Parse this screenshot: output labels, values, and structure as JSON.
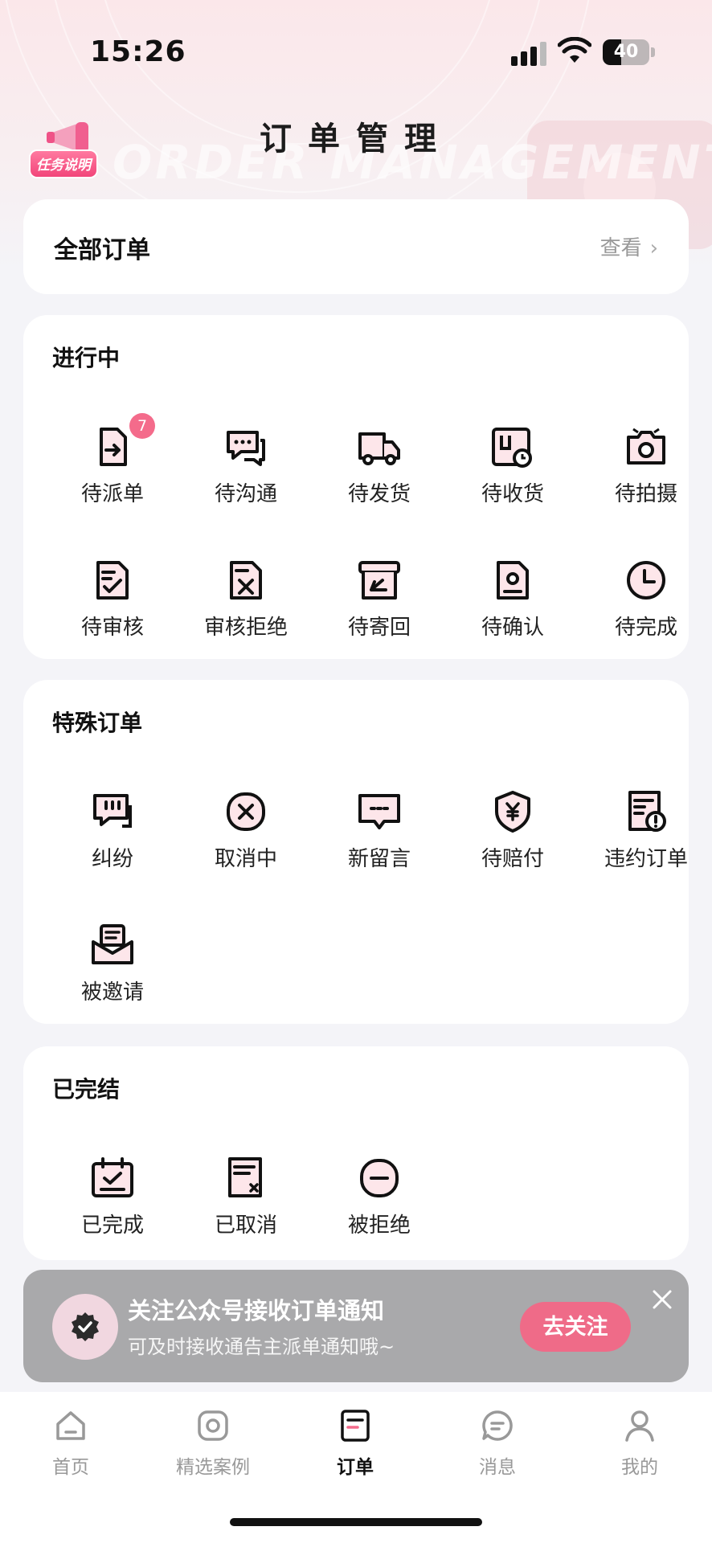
{
  "status_bar": {
    "time": "15:26",
    "battery": "40"
  },
  "header": {
    "title": "订单管理",
    "task_label": "任务说明",
    "watermark": "ORDER MANAGEMENT"
  },
  "all_orders": {
    "label": "全部订单",
    "view": "查看"
  },
  "in_progress": {
    "title": "进行中",
    "items": [
      {
        "label": "待派单",
        "icon": "document-arrow-icon",
        "badge": "7"
      },
      {
        "label": "待沟通",
        "icon": "chat-bubbles-icon"
      },
      {
        "label": "待发货",
        "icon": "delivery-truck-icon"
      },
      {
        "label": "待收货",
        "icon": "package-clock-icon"
      },
      {
        "label": "待拍摄",
        "icon": "camera-icon"
      },
      {
        "label": "待审核",
        "icon": "document-check-icon"
      },
      {
        "label": "审核拒绝",
        "icon": "document-x-icon"
      },
      {
        "label": "待寄回",
        "icon": "return-box-icon"
      },
      {
        "label": "待确认",
        "icon": "document-person-icon"
      },
      {
        "label": "待完成",
        "icon": "clock-icon"
      }
    ]
  },
  "special": {
    "title": "特殊订单",
    "items": [
      {
        "label": "纠纷",
        "icon": "chat-alert-icon"
      },
      {
        "label": "取消中",
        "icon": "circle-x-icon"
      },
      {
        "label": "新留言",
        "icon": "message-dots-icon"
      },
      {
        "label": "待赔付",
        "icon": "shield-yen-icon"
      },
      {
        "label": "违约订单",
        "icon": "document-alert-icon"
      },
      {
        "label": "被邀请",
        "icon": "envelope-icon"
      }
    ]
  },
  "completed": {
    "title": "已完结",
    "items": [
      {
        "label": "已完成",
        "icon": "calendar-check-icon"
      },
      {
        "label": "已取消",
        "icon": "document-cancel-icon"
      },
      {
        "label": "被拒绝",
        "icon": "circle-minus-icon"
      }
    ]
  },
  "banner": {
    "title": "关注公众号接收订单通知",
    "subtitle": "可及时接收通告主派单通知哦~",
    "button": "去关注"
  },
  "tabbar": [
    {
      "label": "首页",
      "icon": "home-icon"
    },
    {
      "label": "精选案例",
      "icon": "camera-square-icon"
    },
    {
      "label": "订单",
      "icon": "order-icon",
      "active": true
    },
    {
      "label": "消息",
      "icon": "message-icon"
    },
    {
      "label": "我的",
      "icon": "user-icon"
    }
  ],
  "colors": {
    "accent": "#f46b8b",
    "icon_fill": "#fde6ea",
    "stroke": "#111111"
  }
}
